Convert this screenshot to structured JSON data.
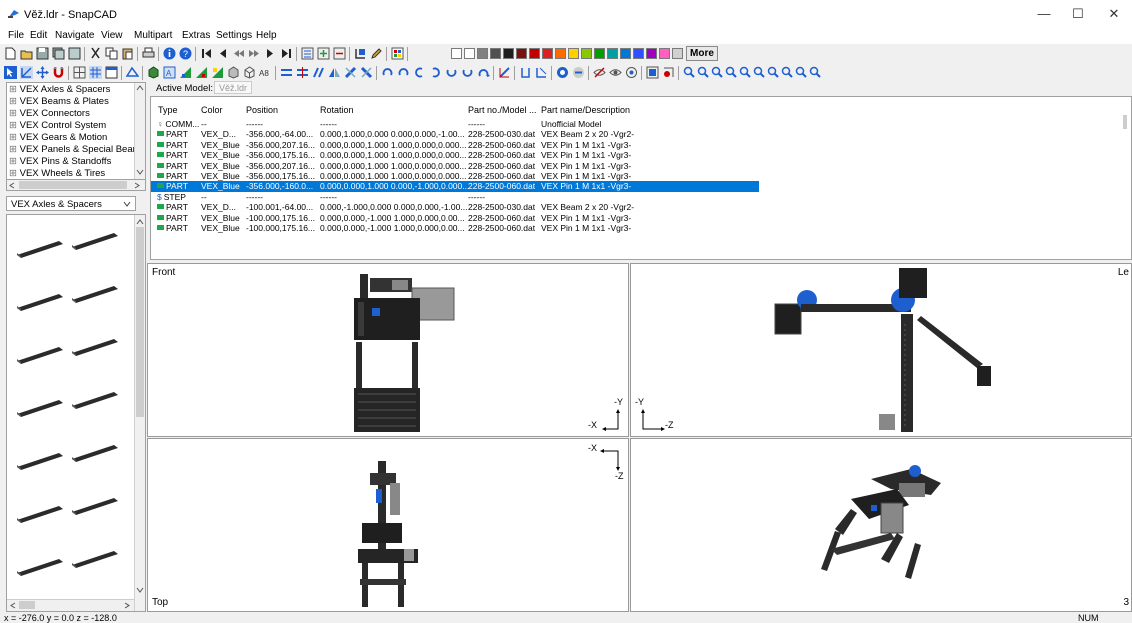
{
  "window": {
    "title": "Věž.ldr - SnapCAD",
    "minimize": "—",
    "maximize": "☐",
    "close": "✕"
  },
  "menu": [
    "File",
    "Edit",
    "Navigate",
    "View",
    "Multipart",
    "Extras",
    "Settings",
    "Help"
  ],
  "toolbar": {
    "more_label": "More",
    "swatch_colors": [
      "#ffffff",
      "#ffffff",
      "#808080",
      "#505050",
      "#1e1e1e",
      "#7a1010",
      "#c00000",
      "#e02020",
      "#ff6a00",
      "#ffd000",
      "#88c800",
      "#00a000",
      "#00a0a0",
      "#0078d7",
      "#3050ff",
      "#a000c0",
      "#ff60c0",
      "#d0d0d0"
    ]
  },
  "parts_tree": [
    "VEX Axles & Spacers",
    "VEX Beams & Plates",
    "VEX Connectors",
    "VEX Control System",
    "VEX Gears & Motion",
    "VEX Panels & Special Beams",
    "VEX Pins & Standoffs",
    "VEX Wheels & Tires"
  ],
  "category_select": "VEX Axles & Spacers",
  "model_bar": {
    "label": "Active Model:",
    "value": "Věž.ldr"
  },
  "table": {
    "headers": [
      "Type",
      "Color",
      "Position",
      "Rotation",
      "Part no./Model ...",
      "Part name/Description"
    ],
    "rows": [
      {
        "type": "COMM...",
        "color": "--",
        "position": "------",
        "rotation": "------",
        "part": "------",
        "desc": "Unofficial Model",
        "kind": "comment",
        "selected": false
      },
      {
        "type": "PART",
        "color": "VEX_D...",
        "position": "-356.000,-64.00...",
        "rotation": "0.000,1.000,0.000 0.000,0.000,-1.00...",
        "part": "228-2500-030.dat",
        "desc": "VEX Beam  2 x 20 -Vgr2-",
        "kind": "part",
        "selected": false
      },
      {
        "type": "PART",
        "color": "VEX_Blue",
        "position": "-356.000,207.16...",
        "rotation": "0.000,0.000,1.000 1.000,0.000,0.000...",
        "part": "228-2500-060.dat",
        "desc": "VEX Pin  1 M 1x1 -Vgr3-",
        "kind": "part",
        "selected": false
      },
      {
        "type": "PART",
        "color": "VEX_Blue",
        "position": "-356.000,175.16...",
        "rotation": "0.000,0.000,1.000 1.000,0.000,0.000...",
        "part": "228-2500-060.dat",
        "desc": "VEX Pin  1 M 1x1 -Vgr3-",
        "kind": "part",
        "selected": false
      },
      {
        "type": "PART",
        "color": "VEX_Blue",
        "position": "-356.000,207.16...",
        "rotation": "0.000,0.000,1.000 1.000,0.000,0.000...",
        "part": "228-2500-060.dat",
        "desc": "VEX Pin  1 M 1x1 -Vgr3-",
        "kind": "part",
        "selected": false
      },
      {
        "type": "PART",
        "color": "VEX_Blue",
        "position": "-356.000,175.16...",
        "rotation": "0.000,0.000,1.000 1.000,0.000,0.000...",
        "part": "228-2500-060.dat",
        "desc": "VEX Pin  1 M 1x1 -Vgr3-",
        "kind": "part",
        "selected": false
      },
      {
        "type": "PART",
        "color": "VEX_Blue",
        "position": "-356.000,-160.0...",
        "rotation": "0.000,0.000,1.000 0.000,-1.000,0.000...",
        "part": "228-2500-060.dat",
        "desc": "VEX Pin  1 M 1x1 -Vgr3-",
        "kind": "part",
        "selected": true
      },
      {
        "type": "STEP",
        "color": "--",
        "position": "------",
        "rotation": "------",
        "part": "------",
        "desc": "",
        "kind": "step",
        "selected": false
      },
      {
        "type": "PART",
        "color": "VEX_D...",
        "position": "-100.001,-64.00...",
        "rotation": "0.000,-1.000,0.000 0.000,0.000,-1.00...",
        "part": "228-2500-030.dat",
        "desc": "VEX Beam  2 x 20 -Vgr2-",
        "kind": "part",
        "selected": false
      },
      {
        "type": "PART",
        "color": "VEX_Blue",
        "position": "-100.000,175.16...",
        "rotation": "0.000,0.000,-1.000 1.000,0.000,0.00...",
        "part": "228-2500-060.dat",
        "desc": "VEX Pin  1 M 1x1 -Vgr3-",
        "kind": "part",
        "selected": false
      },
      {
        "type": "PART",
        "color": "VEX_Blue",
        "position": "-100.000,175.16...",
        "rotation": "0.000,0.000,-1.000 1.000,0.000,0.00...",
        "part": "228-2500-060.dat",
        "desc": "VEX Pin  1 M 1x1 -Vgr3-",
        "kind": "part",
        "selected": false
      }
    ]
  },
  "viewports": {
    "front_label": "Front",
    "left_label": "Le",
    "top_label": "Top",
    "br_edge_label": "3",
    "axes": {
      "front_up": "-Y",
      "front_side": "-X",
      "left_up": "-Y",
      "left_side": "-Z",
      "top_side": "-X",
      "top_down": "-Z"
    }
  },
  "status": {
    "coords": "x = -276.0  y = 0.0  z = -128.0",
    "num": "NUM"
  }
}
